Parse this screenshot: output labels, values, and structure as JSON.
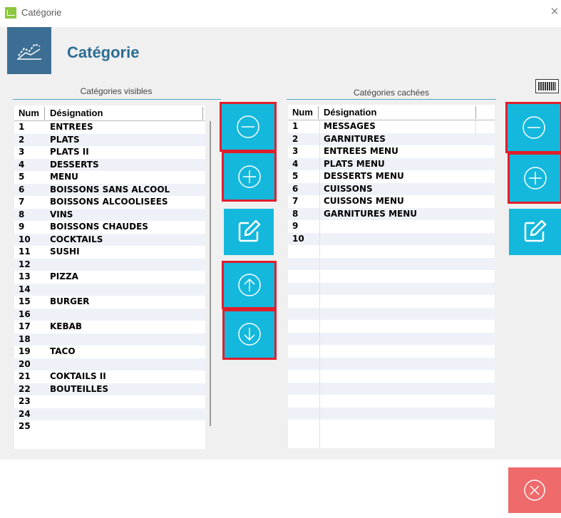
{
  "window": {
    "title": "Catégorie"
  },
  "header": {
    "title": "Catégorie"
  },
  "visible_panel": {
    "label": "Catégories visibles",
    "columns": [
      "Num",
      "Désignation"
    ],
    "rows": [
      {
        "num": "1",
        "des": "ENTREES"
      },
      {
        "num": "2",
        "des": "PLATS"
      },
      {
        "num": "3",
        "des": "PLATS II"
      },
      {
        "num": "4",
        "des": "DESSERTS"
      },
      {
        "num": "5",
        "des": "MENU"
      },
      {
        "num": "6",
        "des": "BOISSONS SANS ALCOOL"
      },
      {
        "num": "7",
        "des": "BOISSONS ALCOOLISEES"
      },
      {
        "num": "8",
        "des": "VINS"
      },
      {
        "num": "9",
        "des": "BOISSONS CHAUDES"
      },
      {
        "num": "10",
        "des": "COCKTAILS"
      },
      {
        "num": "11",
        "des": "SUSHI"
      },
      {
        "num": "12",
        "des": ""
      },
      {
        "num": "13",
        "des": "PIZZA"
      },
      {
        "num": "14",
        "des": ""
      },
      {
        "num": "15",
        "des": "BURGER"
      },
      {
        "num": "16",
        "des": ""
      },
      {
        "num": "17",
        "des": "KEBAB"
      },
      {
        "num": "18",
        "des": ""
      },
      {
        "num": "19",
        "des": "TACO"
      },
      {
        "num": "20",
        "des": ""
      },
      {
        "num": "21",
        "des": "COKTAILS II"
      },
      {
        "num": "22",
        "des": "BOUTEILLES"
      },
      {
        "num": "23",
        "des": ""
      },
      {
        "num": "24",
        "des": ""
      },
      {
        "num": "25",
        "des": ""
      }
    ]
  },
  "hidden_panel": {
    "label": "Catégories cachées",
    "columns": [
      "Num",
      "Désignation"
    ],
    "rows": [
      {
        "num": "1",
        "des": "MESSAGES"
      },
      {
        "num": "2",
        "des": "GARNITURES"
      },
      {
        "num": "3",
        "des": "ENTREES MENU"
      },
      {
        "num": "4",
        "des": "PLATS MENU"
      },
      {
        "num": "5",
        "des": "DESSERTS MENU"
      },
      {
        "num": "6",
        "des": "CUISSONS"
      },
      {
        "num": "7",
        "des": "CUISSONS MENU"
      },
      {
        "num": "8",
        "des": "GARNITURES MENU"
      },
      {
        "num": "9",
        "des": ""
      },
      {
        "num": "10",
        "des": ""
      },
      {
        "num": "",
        "des": ""
      },
      {
        "num": "",
        "des": ""
      },
      {
        "num": "",
        "des": ""
      },
      {
        "num": "",
        "des": ""
      },
      {
        "num": "",
        "des": ""
      },
      {
        "num": "",
        "des": ""
      },
      {
        "num": "",
        "des": ""
      },
      {
        "num": "",
        "des": ""
      },
      {
        "num": "",
        "des": ""
      },
      {
        "num": "",
        "des": ""
      },
      {
        "num": "",
        "des": ""
      },
      {
        "num": "",
        "des": ""
      },
      {
        "num": "",
        "des": ""
      },
      {
        "num": "",
        "des": ""
      },
      {
        "num": "",
        "des": ""
      }
    ]
  },
  "icons": {
    "app": "chart-icon",
    "header": "chart-trend-icon",
    "keyboard": "keyboard-icon",
    "remove": "minus-circle-icon",
    "add": "plus-circle-icon",
    "edit": "edit-icon",
    "up": "arrow-up-circle-icon",
    "down": "arrow-down-circle-icon",
    "close": "close-circle-icon"
  },
  "colors": {
    "action_button": "#14b8dd",
    "highlight_outline": "#e01e2b",
    "header_logo_bg": "#3c6e93",
    "title_text": "#2a6d94",
    "close_button": "#ef6a6b"
  }
}
